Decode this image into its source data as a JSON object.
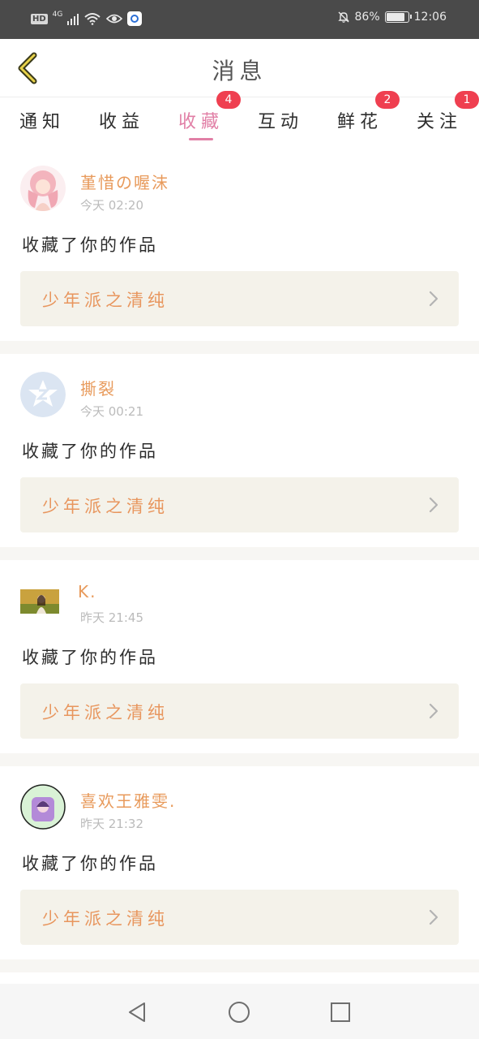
{
  "status_bar": {
    "hd": "HD",
    "network": "4G",
    "battery": "86%",
    "battery_level": 0.86,
    "time": "12:06",
    "icons": [
      "signal-icon",
      "wifi-icon",
      "eye-icon",
      "app-icon",
      "mute-icon",
      "battery-icon"
    ]
  },
  "header": {
    "title": "消息",
    "back_icon": "back-arrow-icon"
  },
  "tabs": [
    {
      "label": "通知",
      "badge": ""
    },
    {
      "label": "收益",
      "badge": ""
    },
    {
      "label": "收藏",
      "badge": "4",
      "active": true
    },
    {
      "label": "互动",
      "badge": ""
    },
    {
      "label": "鲜花",
      "badge": "2"
    },
    {
      "label": "关注",
      "badge": "1"
    }
  ],
  "messages": [
    {
      "user": "堇惜の喔沫",
      "time": "今天 02:20",
      "action": "收藏了你的作品",
      "work": "少年派之清纯"
    },
    {
      "user": "撕裂",
      "time": "今天 00:21",
      "action": "收藏了你的作品",
      "work": "少年派之清纯"
    },
    {
      "user": "K.",
      "time": "昨天 21:45",
      "action": "收藏了你的作品",
      "work": "少年派之清纯"
    },
    {
      "user": "喜欢王雅雯.",
      "time": "昨天 21:32",
      "action": "收藏了你的作品",
      "work": "少年派之清纯"
    }
  ],
  "colors": {
    "accent": "#e17fa6",
    "username": "#e89a5b",
    "badge": "#ef3f50",
    "card_bg": "#f4f2ea"
  },
  "nav": [
    "back-triangle-icon",
    "home-circle-icon",
    "recents-square-icon"
  ]
}
